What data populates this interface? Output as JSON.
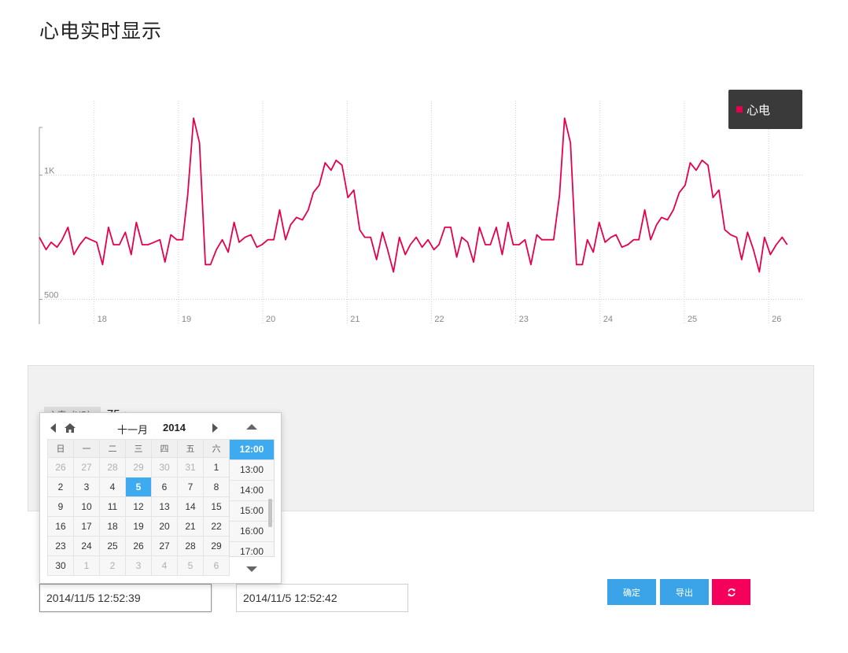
{
  "page": {
    "title": "心电实时显示"
  },
  "legend": {
    "label": "心电"
  },
  "colors": {
    "series": "#e5004f",
    "accent_blue": "#3ba4e8",
    "accent_pink": "#f5005a",
    "legend_bg": "#3a3a3a"
  },
  "heart_rate": {
    "label": "心率（HR）",
    "value": "75",
    "unit": "bpm"
  },
  "datepicker": {
    "month": "十一月",
    "year": "2014",
    "weekdays": [
      "日",
      "一",
      "二",
      "三",
      "四",
      "五",
      "六"
    ],
    "weeks": [
      [
        "26",
        "27",
        "28",
        "29",
        "30",
        "31",
        "1"
      ],
      [
        "2",
        "3",
        "4",
        "5",
        "6",
        "7",
        "8"
      ],
      [
        "9",
        "10",
        "11",
        "12",
        "13",
        "14",
        "15"
      ],
      [
        "16",
        "17",
        "18",
        "19",
        "20",
        "21",
        "22"
      ],
      [
        "23",
        "24",
        "25",
        "26",
        "27",
        "28",
        "29"
      ],
      [
        "30",
        "1",
        "2",
        "3",
        "4",
        "5",
        "6"
      ]
    ],
    "selected_day": "5",
    "times": [
      "12:00",
      "13:00",
      "14:00",
      "15:00",
      "16:00",
      "17:00"
    ],
    "selected_time": "12:00"
  },
  "inputs": {
    "start_value": "2014/11/5 12:52:39",
    "end_value": "2014/11/5 12:52:42"
  },
  "buttons": {
    "confirm": "确定",
    "export": "导出",
    "refresh_icon": "refresh-icon"
  },
  "chart_data": {
    "type": "line",
    "series": [
      {
        "name": "心电",
        "color": "#e5004f"
      }
    ],
    "ylim": [
      400,
      1300
    ],
    "y_ticks": [
      500,
      1000
    ],
    "y_tick_labels": [
      "500",
      "1K"
    ],
    "x_ticks": [
      18,
      19,
      20,
      21,
      22,
      23,
      24,
      25,
      26
    ],
    "xlim": [
      17.35,
      26.4
    ],
    "x": [
      17.35,
      17.43,
      17.49,
      17.56,
      17.62,
      17.69,
      17.76,
      17.83,
      17.9,
      17.96,
      18.03,
      18.1,
      18.17,
      18.23,
      18.3,
      18.37,
      18.44,
      18.5,
      18.57,
      18.64,
      18.71,
      18.78,
      18.84,
      18.91,
      18.98,
      19.05,
      19.11,
      19.18,
      19.25,
      19.32,
      19.38,
      19.45,
      19.52,
      19.59,
      19.66,
      19.72,
      19.79,
      19.86,
      19.93,
      19.99,
      20.06,
      20.13,
      20.2,
      20.27,
      20.33,
      20.4,
      20.47,
      20.54,
      20.6,
      20.67,
      20.74,
      20.81,
      20.87,
      20.94,
      21.01,
      21.08,
      21.15,
      21.21,
      21.28,
      21.35,
      21.42,
      21.48,
      21.55,
      21.62,
      21.69,
      21.75,
      21.82,
      21.89,
      21.96,
      22.03,
      22.09,
      22.16,
      22.23,
      22.3,
      22.36,
      22.43,
      22.5,
      22.57,
      22.64,
      22.7,
      22.77,
      22.84,
      22.91,
      22.97,
      23.04,
      23.11,
      23.18,
      23.25,
      23.31,
      23.38,
      23.45,
      23.52,
      23.58,
      23.65,
      23.72,
      23.79,
      23.85,
      23.92,
      23.99,
      24.06,
      24.13,
      24.19,
      24.26,
      24.33,
      24.4,
      24.46,
      24.53,
      24.6,
      24.67,
      24.73,
      24.8,
      24.87,
      24.94,
      25.01,
      25.07,
      25.14,
      25.21,
      25.28,
      25.34,
      25.41,
      25.48,
      25.55,
      25.62,
      25.68,
      25.75,
      25.82,
      25.89,
      25.95,
      26.02,
      26.09,
      26.16,
      26.22,
      26.29,
      26.36
    ],
    "y": [
      750,
      700,
      730,
      710,
      740,
      790,
      680,
      720,
      750,
      740,
      730,
      640,
      790,
      720,
      720,
      770,
      680,
      810,
      720,
      720,
      730,
      740,
      650,
      760,
      740,
      740,
      920,
      1230,
      1130,
      640,
      640,
      700,
      740,
      690,
      810,
      730,
      750,
      760,
      710,
      720,
      740,
      740,
      860,
      740,
      800,
      830,
      820,
      860,
      930,
      960,
      1050,
      1020,
      1060,
      1040,
      910,
      940,
      780,
      750,
      750,
      660,
      770,
      700,
      610,
      750,
      680,
      720,
      750,
      710,
      740,
      700,
      720,
      790,
      790,
      670,
      750,
      730,
      650,
      790,
      720,
      720,
      790,
      680,
      810,
      720,
      720,
      740,
      640,
      760,
      740,
      740,
      740,
      920,
      1230,
      1130,
      640,
      640,
      740,
      690,
      810,
      730,
      750,
      760,
      710,
      720,
      740,
      740,
      860,
      740,
      800,
      830,
      820,
      860,
      930,
      960,
      1050,
      1020,
      1060,
      1040,
      910,
      940,
      780,
      760,
      750,
      660,
      770,
      700,
      610,
      750,
      680,
      720,
      750,
      720
    ]
  }
}
